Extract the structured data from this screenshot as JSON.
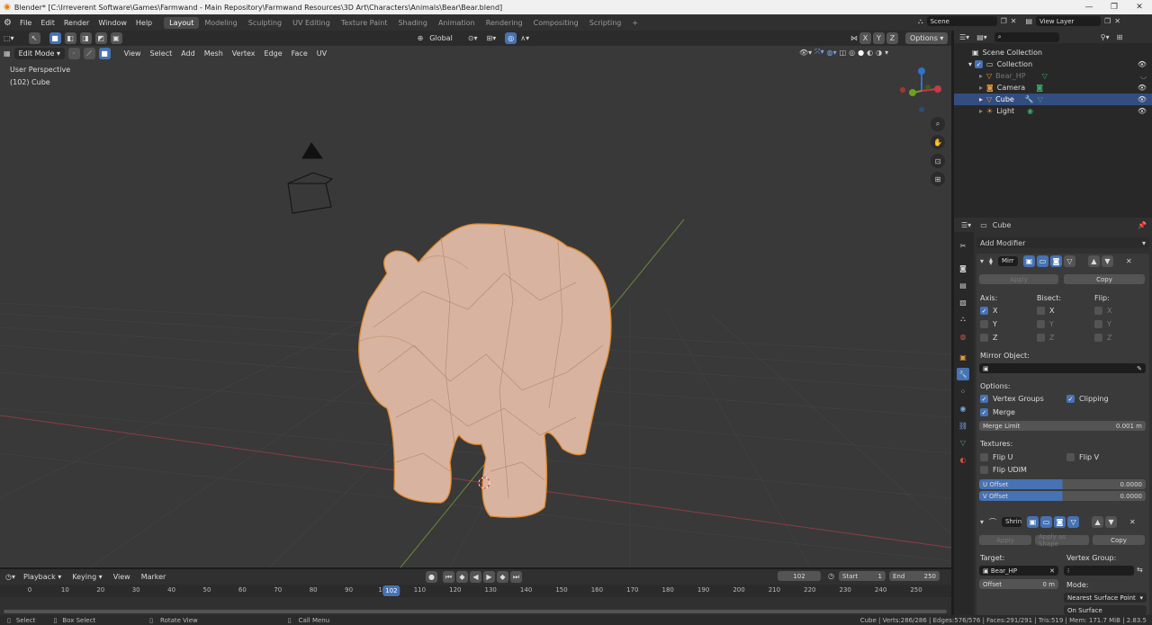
{
  "window": {
    "title": "Blender* [C:\\Irreverent Software\\Games\\Farmwand - Main Repository\\Farmwand Resources\\3D Art\\Characters\\Animals\\Bear\\Bear.blend]"
  },
  "menu": [
    "File",
    "Edit",
    "Render",
    "Window",
    "Help"
  ],
  "workspaces": [
    "Layout",
    "Modeling",
    "Sculpting",
    "UV Editing",
    "Texture Paint",
    "Shading",
    "Animation",
    "Rendering",
    "Compositing",
    "Scripting"
  ],
  "active_workspace": "Layout",
  "scene": {
    "label": "Scene",
    "view_layer": "View Layer"
  },
  "toolbar": {
    "transform_orientation": "Global",
    "options": "Options",
    "axes": [
      "X",
      "Y",
      "Z"
    ]
  },
  "viewport_header": {
    "mode": "Edit Mode",
    "menus": [
      "View",
      "Select",
      "Add",
      "Mesh",
      "Vertex",
      "Edge",
      "Face",
      "UV"
    ]
  },
  "viewport": {
    "perspective": "User Perspective",
    "object": "(102) Cube"
  },
  "outliner": {
    "root": "Scene Collection",
    "collection": "Collection",
    "items": [
      {
        "name": "Bear_HP",
        "dim": true
      },
      {
        "name": "Camera",
        "dim": false
      },
      {
        "name": "Cube",
        "dim": false,
        "selected": true
      },
      {
        "name": "Light",
        "dim": false
      }
    ]
  },
  "properties": {
    "object_name": "Cube",
    "add_modifier": "Add Modifier",
    "mirror": {
      "name": "Mirr",
      "apply": "Apply",
      "copy": "Copy",
      "axis_label": "Axis:",
      "bisect_label": "Bisect:",
      "flip_label": "Flip:",
      "axes": [
        "X",
        "Y",
        "Z"
      ],
      "mirror_object_label": "Mirror Object:",
      "options_label": "Options:",
      "vertex_groups": "Vertex Groups",
      "clipping": "Clipping",
      "merge": "Merge",
      "merge_limit_label": "Merge Limit",
      "merge_limit_value": "0.001 m",
      "textures_label": "Textures:",
      "flip_u": "Flip U",
      "flip_v": "Flip V",
      "flip_udim": "Flip UDIM",
      "u_offset_label": "U Offset",
      "u_offset_value": "0.0000",
      "v_offset_label": "V Offset",
      "v_offset_value": "0.0000"
    },
    "shrink": {
      "name": "Shrin",
      "apply": "Apply",
      "apply_shape": "Apply as Shape",
      "copy": "Copy",
      "target_label": "Target:",
      "target_value": "Bear_HP",
      "vertex_group_label": "Vertex Group:",
      "offset_label": "Offset",
      "offset_value": "0 m",
      "mode_label": "Mode:",
      "mode_value": "Nearest Surface Point",
      "on_surface": "On Surface"
    }
  },
  "timeline": {
    "menus": [
      "Playback",
      "Keying",
      "View",
      "Marker"
    ],
    "current_frame": "102",
    "start_label": "Start",
    "start_value": "1",
    "end_label": "End",
    "end_value": "250",
    "ticks": [
      "0",
      "10",
      "20",
      "30",
      "40",
      "50",
      "60",
      "70",
      "80",
      "90",
      "100",
      "110",
      "120",
      "130",
      "140",
      "150",
      "160",
      "170",
      "180",
      "190",
      "200",
      "210",
      "220",
      "230",
      "240",
      "250"
    ]
  },
  "status": {
    "select": "Select",
    "box_select": "Box Select",
    "rotate_view": "Rotate View",
    "call_menu": "Call Menu",
    "stats": "Cube | Verts:286/286 | Edges:576/576 | Faces:291/291 | Tris:519 | Mem: 171.7 MiB | 2.83.5"
  },
  "colors": {
    "accent": "#4772b3",
    "selection_orange": "#e08a2a",
    "mesh": "#d8b4a0"
  }
}
